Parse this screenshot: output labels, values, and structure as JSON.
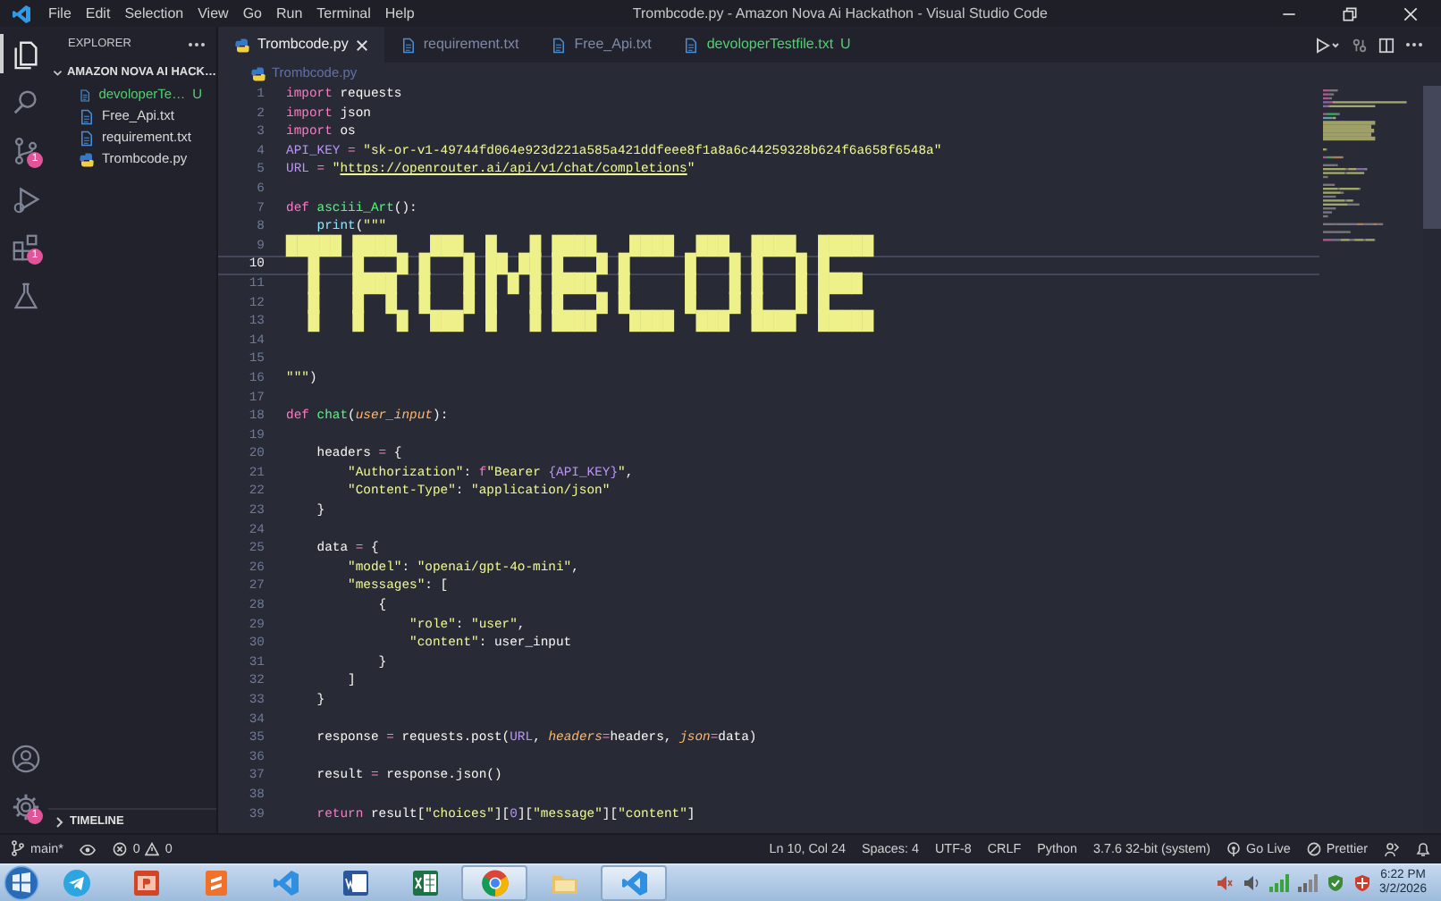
{
  "title_bar": {
    "menu": [
      "File",
      "Edit",
      "Selection",
      "View",
      "Go",
      "Run",
      "Terminal",
      "Help"
    ],
    "title": "Trombcode.py - Amazon Nova Ai Hackathon - Visual Studio Code"
  },
  "activity_bar": {
    "items": [
      {
        "selected": true
      },
      {
        "selected": false
      },
      {
        "selected": false,
        "badge": "1"
      },
      {
        "selected": false
      },
      {
        "selected": false,
        "badge": "1"
      },
      {
        "selected": false
      }
    ],
    "settings_badge": "1"
  },
  "sidebar": {
    "title": "EXPLORER",
    "folder": {
      "name": "AMAZON NOVA AI HACK…",
      "expanded": true,
      "files": [
        {
          "name": "devoloperTe…",
          "kind": "text",
          "untracked": true,
          "status": "U"
        },
        {
          "name": "Free_Api.txt",
          "kind": "text",
          "untracked": false
        },
        {
          "name": "requirement.txt",
          "kind": "text",
          "untracked": false
        },
        {
          "name": "Trombcode.py",
          "kind": "python",
          "untracked": false
        }
      ]
    },
    "timeline": {
      "title": "TIMELINE",
      "expanded": false
    }
  },
  "tabs": [
    {
      "name": "Trombcode.py",
      "kind": "python",
      "selected": true,
      "untracked": false
    },
    {
      "name": "requirement.txt",
      "kind": "text",
      "selected": false,
      "untracked": false
    },
    {
      "name": "Free_Api.txt",
      "kind": "text",
      "selected": false,
      "untracked": false
    },
    {
      "name": "devoloperTestfile.txt",
      "kind": "text",
      "selected": false,
      "untracked": true,
      "status": "U"
    }
  ],
  "breadcrumb": {
    "kind": "python",
    "name": "Trombcode.py"
  },
  "editor": {
    "lines": [
      {
        "number": "1",
        "active": false,
        "tokens": [
          {
            "kind": "kw",
            "text": "import"
          },
          {
            "kind": "plain",
            "text": " requests"
          }
        ]
      },
      {
        "number": "2",
        "active": false,
        "tokens": [
          {
            "kind": "kw",
            "text": "import"
          },
          {
            "kind": "plain",
            "text": " json"
          }
        ]
      },
      {
        "number": "3",
        "active": false,
        "tokens": [
          {
            "kind": "kw",
            "text": "import"
          },
          {
            "kind": "plain",
            "text": " os"
          }
        ]
      },
      {
        "number": "4",
        "active": false,
        "tokens": [
          {
            "kind": "var",
            "text": "API_KEY"
          },
          {
            "kind": "op",
            "text": " = "
          },
          {
            "kind": "str",
            "text": "\"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\""
          }
        ]
      },
      {
        "number": "5",
        "active": false,
        "tokens": [
          {
            "kind": "var",
            "text": "URL"
          },
          {
            "kind": "op",
            "text": " = "
          },
          {
            "kind": "str",
            "text": "\""
          },
          {
            "kind": "url",
            "text": "https://openrouter.ai/api/v1/chat/completions"
          },
          {
            "kind": "str",
            "text": "\""
          }
        ]
      },
      {
        "number": "6",
        "active": false
      },
      {
        "number": "7",
        "active": false,
        "tokens": [
          {
            "kind": "kw",
            "text": "def"
          },
          {
            "kind": "fn",
            "text": " asciii_Art"
          },
          {
            "kind": "plain",
            "text": "():"
          }
        ]
      },
      {
        "number": "8",
        "active": false,
        "tokens": [
          {
            "kind": "builtin",
            "text": "    print"
          },
          {
            "kind": "plain",
            "text": "("
          },
          {
            "kind": "str",
            "text": "\"\"\""
          }
        ]
      },
      {
        "number": "9",
        "active": false,
        "tokens": [
          {
            "kind": "art",
            "text": "█████ ████   ███  █   █ ████   ████  ███  ████  █████"
          }
        ]
      },
      {
        "number": "10",
        "active": true,
        "tokens": [
          {
            "kind": "art",
            "text": "  █   █   █ █   █ ██ ██ █   █ █     █   █ █   █ █"
          }
        ]
      },
      {
        "number": "11",
        "active": false,
        "tokens": [
          {
            "kind": "art",
            "text": "  █   ████  █   █ █ █ █ ████  █     █   █ █   █ ████"
          }
        ]
      },
      {
        "number": "12",
        "active": false,
        "tokens": [
          {
            "kind": "art",
            "text": "  █   █  █  █   █ █   █ █   █ █     █   █ █   █ █"
          }
        ]
      },
      {
        "number": "13",
        "active": false,
        "tokens": [
          {
            "kind": "art",
            "text": "  █   █   █  ███  █   █ ████   ████  ███  ████  █████"
          }
        ]
      },
      {
        "number": "14",
        "active": false
      },
      {
        "number": "15",
        "active": false
      },
      {
        "number": "16",
        "active": false,
        "tokens": [
          {
            "kind": "str",
            "text": "\"\"\""
          },
          {
            "kind": "plain",
            "text": ")"
          }
        ]
      },
      {
        "number": "17",
        "active": false
      },
      {
        "number": "18",
        "active": false,
        "tokens": [
          {
            "kind": "kw",
            "text": "def"
          },
          {
            "kind": "fn",
            "text": " chat"
          },
          {
            "kind": "plain",
            "text": "("
          },
          {
            "kind": "param",
            "text": "user_input"
          },
          {
            "kind": "plain",
            "text": "):"
          }
        ]
      },
      {
        "number": "19",
        "active": false
      },
      {
        "number": "20",
        "active": false,
        "tokens": [
          {
            "kind": "plain",
            "text": "    headers "
          },
          {
            "kind": "op",
            "text": "="
          },
          {
            "kind": "plain",
            "text": " {"
          }
        ]
      },
      {
        "number": "21",
        "active": false,
        "tokens": [
          {
            "kind": "str",
            "text": "        \"Authorization\""
          },
          {
            "kind": "plain",
            "text": ": "
          },
          {
            "kind": "kw",
            "text": "f"
          },
          {
            "kind": "str",
            "text": "\"Bearer "
          },
          {
            "kind": "var",
            "text": "{API_KEY}"
          },
          {
            "kind": "str",
            "text": "\""
          },
          {
            "kind": "plain",
            "text": ","
          }
        ]
      },
      {
        "number": "22",
        "active": false,
        "tokens": [
          {
            "kind": "str",
            "text": "        \"Content-Type\""
          },
          {
            "kind": "plain",
            "text": ": "
          },
          {
            "kind": "str",
            "text": "\"application/json\""
          }
        ]
      },
      {
        "number": "23",
        "active": false,
        "tokens": [
          {
            "kind": "plain",
            "text": "    }"
          }
        ]
      },
      {
        "number": "24",
        "active": false
      },
      {
        "number": "25",
        "active": false,
        "tokens": [
          {
            "kind": "plain",
            "text": "    data "
          },
          {
            "kind": "op",
            "text": "="
          },
          {
            "kind": "plain",
            "text": " {"
          }
        ]
      },
      {
        "number": "26",
        "active": false,
        "tokens": [
          {
            "kind": "str",
            "text": "        \"model\""
          },
          {
            "kind": "plain",
            "text": ": "
          },
          {
            "kind": "str",
            "text": "\"openai/gpt-4o-mini\""
          },
          {
            "kind": "plain",
            "text": ","
          }
        ]
      },
      {
        "number": "27",
        "active": false,
        "tokens": [
          {
            "kind": "str",
            "text": "        \"messages\""
          },
          {
            "kind": "plain",
            "text": ": ["
          }
        ]
      },
      {
        "number": "28",
        "active": false,
        "tokens": [
          {
            "kind": "plain",
            "text": "            {"
          }
        ]
      },
      {
        "number": "29",
        "active": false,
        "tokens": [
          {
            "kind": "str",
            "text": "                \"role\""
          },
          {
            "kind": "plain",
            "text": ": "
          },
          {
            "kind": "str",
            "text": "\"user\""
          },
          {
            "kind": "plain",
            "text": ","
          }
        ]
      },
      {
        "number": "30",
        "active": false,
        "tokens": [
          {
            "kind": "str",
            "text": "                \"content\""
          },
          {
            "kind": "plain",
            "text": ": user_input"
          }
        ]
      },
      {
        "number": "31",
        "active": false,
        "tokens": [
          {
            "kind": "plain",
            "text": "            }"
          }
        ]
      },
      {
        "number": "32",
        "active": false,
        "tokens": [
          {
            "kind": "plain",
            "text": "        ]"
          }
        ]
      },
      {
        "number": "33",
        "active": false,
        "tokens": [
          {
            "kind": "plain",
            "text": "    }"
          }
        ]
      },
      {
        "number": "34",
        "active": false
      },
      {
        "number": "35",
        "active": false,
        "tokens": [
          {
            "kind": "plain",
            "text": "    response "
          },
          {
            "kind": "op",
            "text": "="
          },
          {
            "kind": "plain",
            "text": " requests.post("
          },
          {
            "kind": "var",
            "text": "URL"
          },
          {
            "kind": "plain",
            "text": ", "
          },
          {
            "kind": "param",
            "text": "headers"
          },
          {
            "kind": "op",
            "text": "="
          },
          {
            "kind": "plain",
            "text": "headers, "
          },
          {
            "kind": "param",
            "text": "json"
          },
          {
            "kind": "op",
            "text": "="
          },
          {
            "kind": "plain",
            "text": "data)"
          }
        ]
      },
      {
        "number": "36",
        "active": false
      },
      {
        "number": "37",
        "active": false,
        "tokens": [
          {
            "kind": "plain",
            "text": "    result "
          },
          {
            "kind": "op",
            "text": "="
          },
          {
            "kind": "plain",
            "text": " response.json()"
          }
        ]
      },
      {
        "number": "38",
        "active": false
      },
      {
        "number": "39",
        "active": false,
        "tokens": [
          {
            "kind": "kw",
            "text": "    return"
          },
          {
            "kind": "plain",
            "text": " result["
          },
          {
            "kind": "str",
            "text": "\"choices\""
          },
          {
            "kind": "plain",
            "text": "]["
          },
          {
            "kind": "num",
            "text": "0"
          },
          {
            "kind": "plain",
            "text": "]["
          },
          {
            "kind": "str",
            "text": "\"message\""
          },
          {
            "kind": "plain",
            "text": "]["
          },
          {
            "kind": "str",
            "text": "\"content\""
          },
          {
            "kind": "plain",
            "text": "]"
          }
        ]
      }
    ]
  },
  "status_bar": {
    "branch": "main*",
    "errors": "0",
    "warnings": "0",
    "items": [
      "Ln 10, Col 24",
      "Spaces: 4",
      "UTF-8",
      "CRLF",
      "Python",
      "3.7.6 32-bit (system)"
    ],
    "go_live": "Go Live",
    "prettier": "Prettier"
  },
  "taskbar": {
    "apps": [
      {
        "active": false
      },
      {
        "active": false
      },
      {
        "active": false
      },
      {
        "active": false
      },
      {
        "active": false
      },
      {
        "active": false
      },
      {
        "active": true
      },
      {
        "active": false
      },
      {
        "active": true
      }
    ],
    "time": "6:22 PM",
    "date": "3/2/2026"
  }
}
